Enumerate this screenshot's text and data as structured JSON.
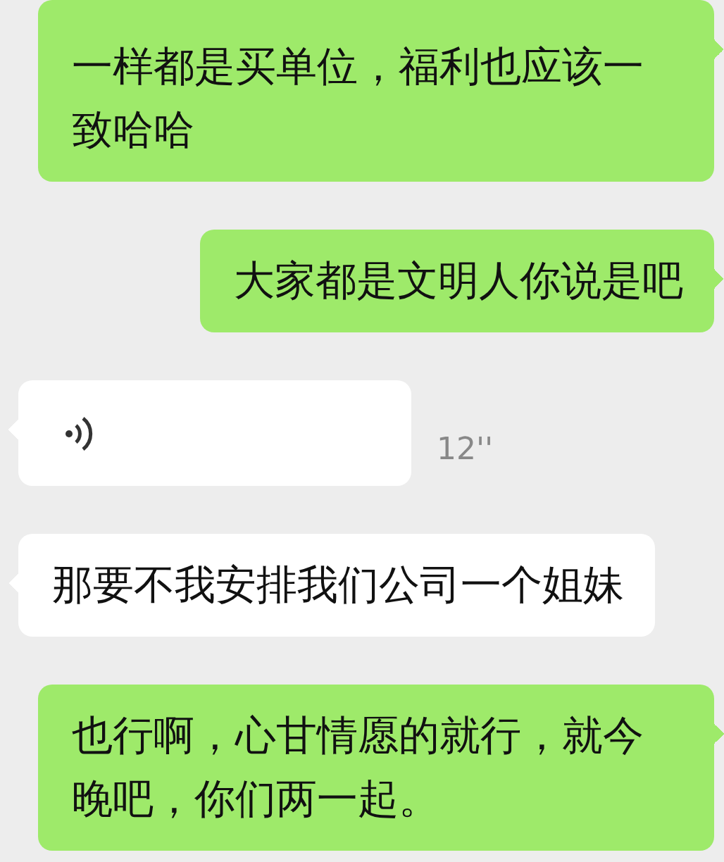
{
  "messages": [
    {
      "kind": "text",
      "outgoing": true,
      "text": "一样都是买单位，福利也应该一致哈哈"
    },
    {
      "kind": "text",
      "outgoing": true,
      "text": "大家都是文明人你说是吧"
    },
    {
      "kind": "voice",
      "outgoing": false,
      "duration": "12''"
    },
    {
      "kind": "text",
      "outgoing": false,
      "text": "那要不我安排我们公司一个姐妹"
    },
    {
      "kind": "text",
      "outgoing": true,
      "text": "也行啊，心甘情愿的就行，就今晚吧，你们两一起。"
    }
  ]
}
